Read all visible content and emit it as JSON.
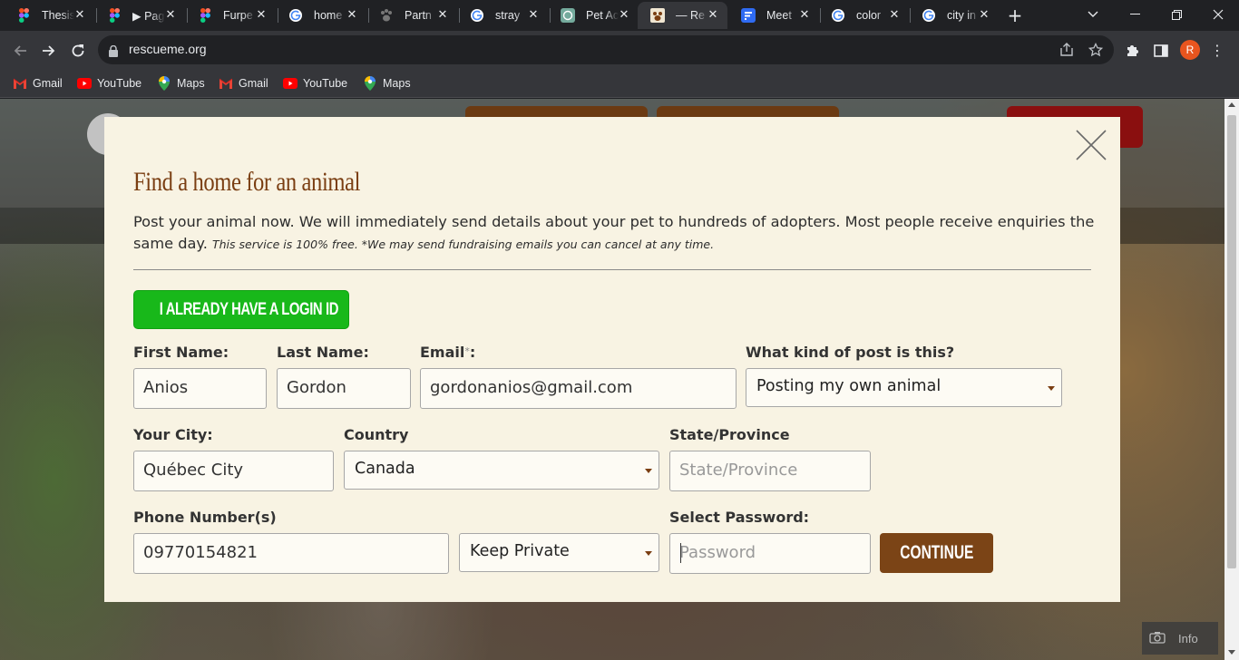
{
  "browser": {
    "tabs": [
      {
        "label": "Thesis",
        "icon": "figma-icon"
      },
      {
        "label": "▶ Pag",
        "icon": "figma-icon"
      },
      {
        "label": "Furpe",
        "icon": "figma-icon"
      },
      {
        "label": "home",
        "icon": "google-icon"
      },
      {
        "label": "Partn",
        "icon": "paw-icon"
      },
      {
        "label": "stray",
        "icon": "google-icon"
      },
      {
        "label": "Pet Ac",
        "icon": "chatgpt-icon"
      },
      {
        "label": "— Re",
        "icon": "rescueme-icon",
        "active": true
      },
      {
        "label": "Meet",
        "icon": "forms-icon"
      },
      {
        "label": "color",
        "icon": "google-icon"
      },
      {
        "label": "city in",
        "icon": "google-icon"
      }
    ],
    "close_glyph": "✕",
    "new_tab_glyph": "+",
    "url": "rescueme.org",
    "profile_initial": "R",
    "bookmarks": [
      {
        "label": "Gmail",
        "icon": "gmail-icon"
      },
      {
        "label": "YouTube",
        "icon": "youtube-icon"
      },
      {
        "label": "Maps",
        "icon": "maps-icon"
      },
      {
        "label": "Gmail",
        "icon": "gmail-icon"
      },
      {
        "label": "YouTube",
        "icon": "youtube-icon"
      },
      {
        "label": "Maps",
        "icon": "maps-icon"
      }
    ]
  },
  "page": {
    "info_label": "Info"
  },
  "modal": {
    "title": "Find a home for an animal",
    "lead": "Post your animal now. We will immediately send details about your pet to hundreds of adopters. Most people receive enquiries the same day.",
    "lead_small": "This service is 100% free. *We may send fundraising emails you can cancel at any time.",
    "login_button": "I ALREADY HAVE A LOGIN ID",
    "fields": {
      "first_name": {
        "label": "First Name:",
        "value": "Anios"
      },
      "last_name": {
        "label": "Last Name:",
        "value": "Gordon"
      },
      "email": {
        "label": "Email",
        "required_mark": "*",
        "label_suffix": ":",
        "value": "gordonanios@gmail.com"
      },
      "post_kind": {
        "label": "What kind of post is this?",
        "selected": "Posting my own animal"
      },
      "city": {
        "label": "Your City:",
        "value": "Québec City"
      },
      "country": {
        "label": "Country",
        "selected": "Canada"
      },
      "state": {
        "label": "State/Province",
        "placeholder": "State/Province"
      },
      "phone": {
        "label": "Phone Number(s)",
        "value": "09770154821"
      },
      "phone_privacy": {
        "selected": "Keep Private"
      },
      "password": {
        "label": "Select Password:",
        "placeholder": "Password"
      }
    },
    "continue_button": "CONTINUE"
  },
  "colors": {
    "modal_bg": "#f8f3e3",
    "title_brown": "#7a3e12",
    "login_green": "#18b81a",
    "continue_brown": "#7b4416"
  }
}
